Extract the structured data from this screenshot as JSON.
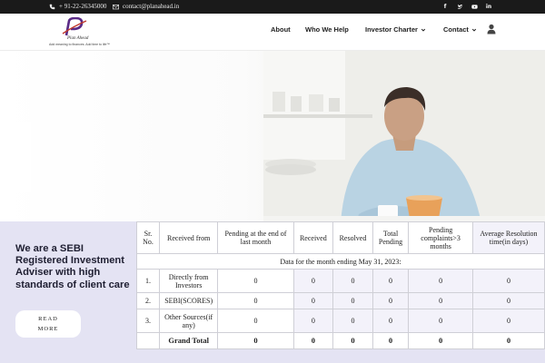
{
  "topbar": {
    "phone": "+ 91-22-26345000",
    "email": "contact@planahead.in",
    "social_icons": [
      "facebook-icon",
      "twitter-icon",
      "youtube-icon",
      "linkedin-icon"
    ]
  },
  "header": {
    "logo": {
      "brand": "Plan Ahead",
      "tagline": "Add meaning to finances. Add time to life™"
    },
    "nav": [
      {
        "label": "About",
        "has_dropdown": false
      },
      {
        "label": "Who We Help",
        "has_dropdown": false
      },
      {
        "label": "Investor Charter",
        "has_dropdown": true
      },
      {
        "label": "Contact",
        "has_dropdown": true
      }
    ],
    "user_icon": "user-icon"
  },
  "intro": {
    "headline": "We are a SEBI Registered Investment Adviser with high standards of client care",
    "read_more_label": "READ MORE"
  },
  "complaints_table": {
    "caption": "Data for the month ending May 31, 2023:",
    "columns": [
      "Sr. No.",
      "Received from",
      "Pending at the end of last month",
      "Received",
      "Resolved",
      "Total Pending",
      "Pending complaints>3 months",
      "Average Resolution time(in days)"
    ],
    "rows": [
      [
        "1.",
        "Directly from Investors",
        "0",
        "0",
        "0",
        "0",
        "0",
        "0"
      ],
      [
        "2.",
        "SEBI(SCORES)",
        "0",
        "0",
        "0",
        "0",
        "0",
        "0"
      ],
      [
        "3.",
        "Other Sources(if any)",
        "0",
        "0",
        "0",
        "0",
        "0",
        "0"
      ]
    ],
    "total_row": [
      "",
      "Grand Total",
      "0",
      "0",
      "0",
      "0",
      "0",
      "0"
    ]
  },
  "colors": {
    "topbar_bg": "#1a1a1a",
    "lower_section_bg": "#e4e3f3",
    "headline_text": "#202033",
    "logo_accent": "#5a2a86"
  }
}
